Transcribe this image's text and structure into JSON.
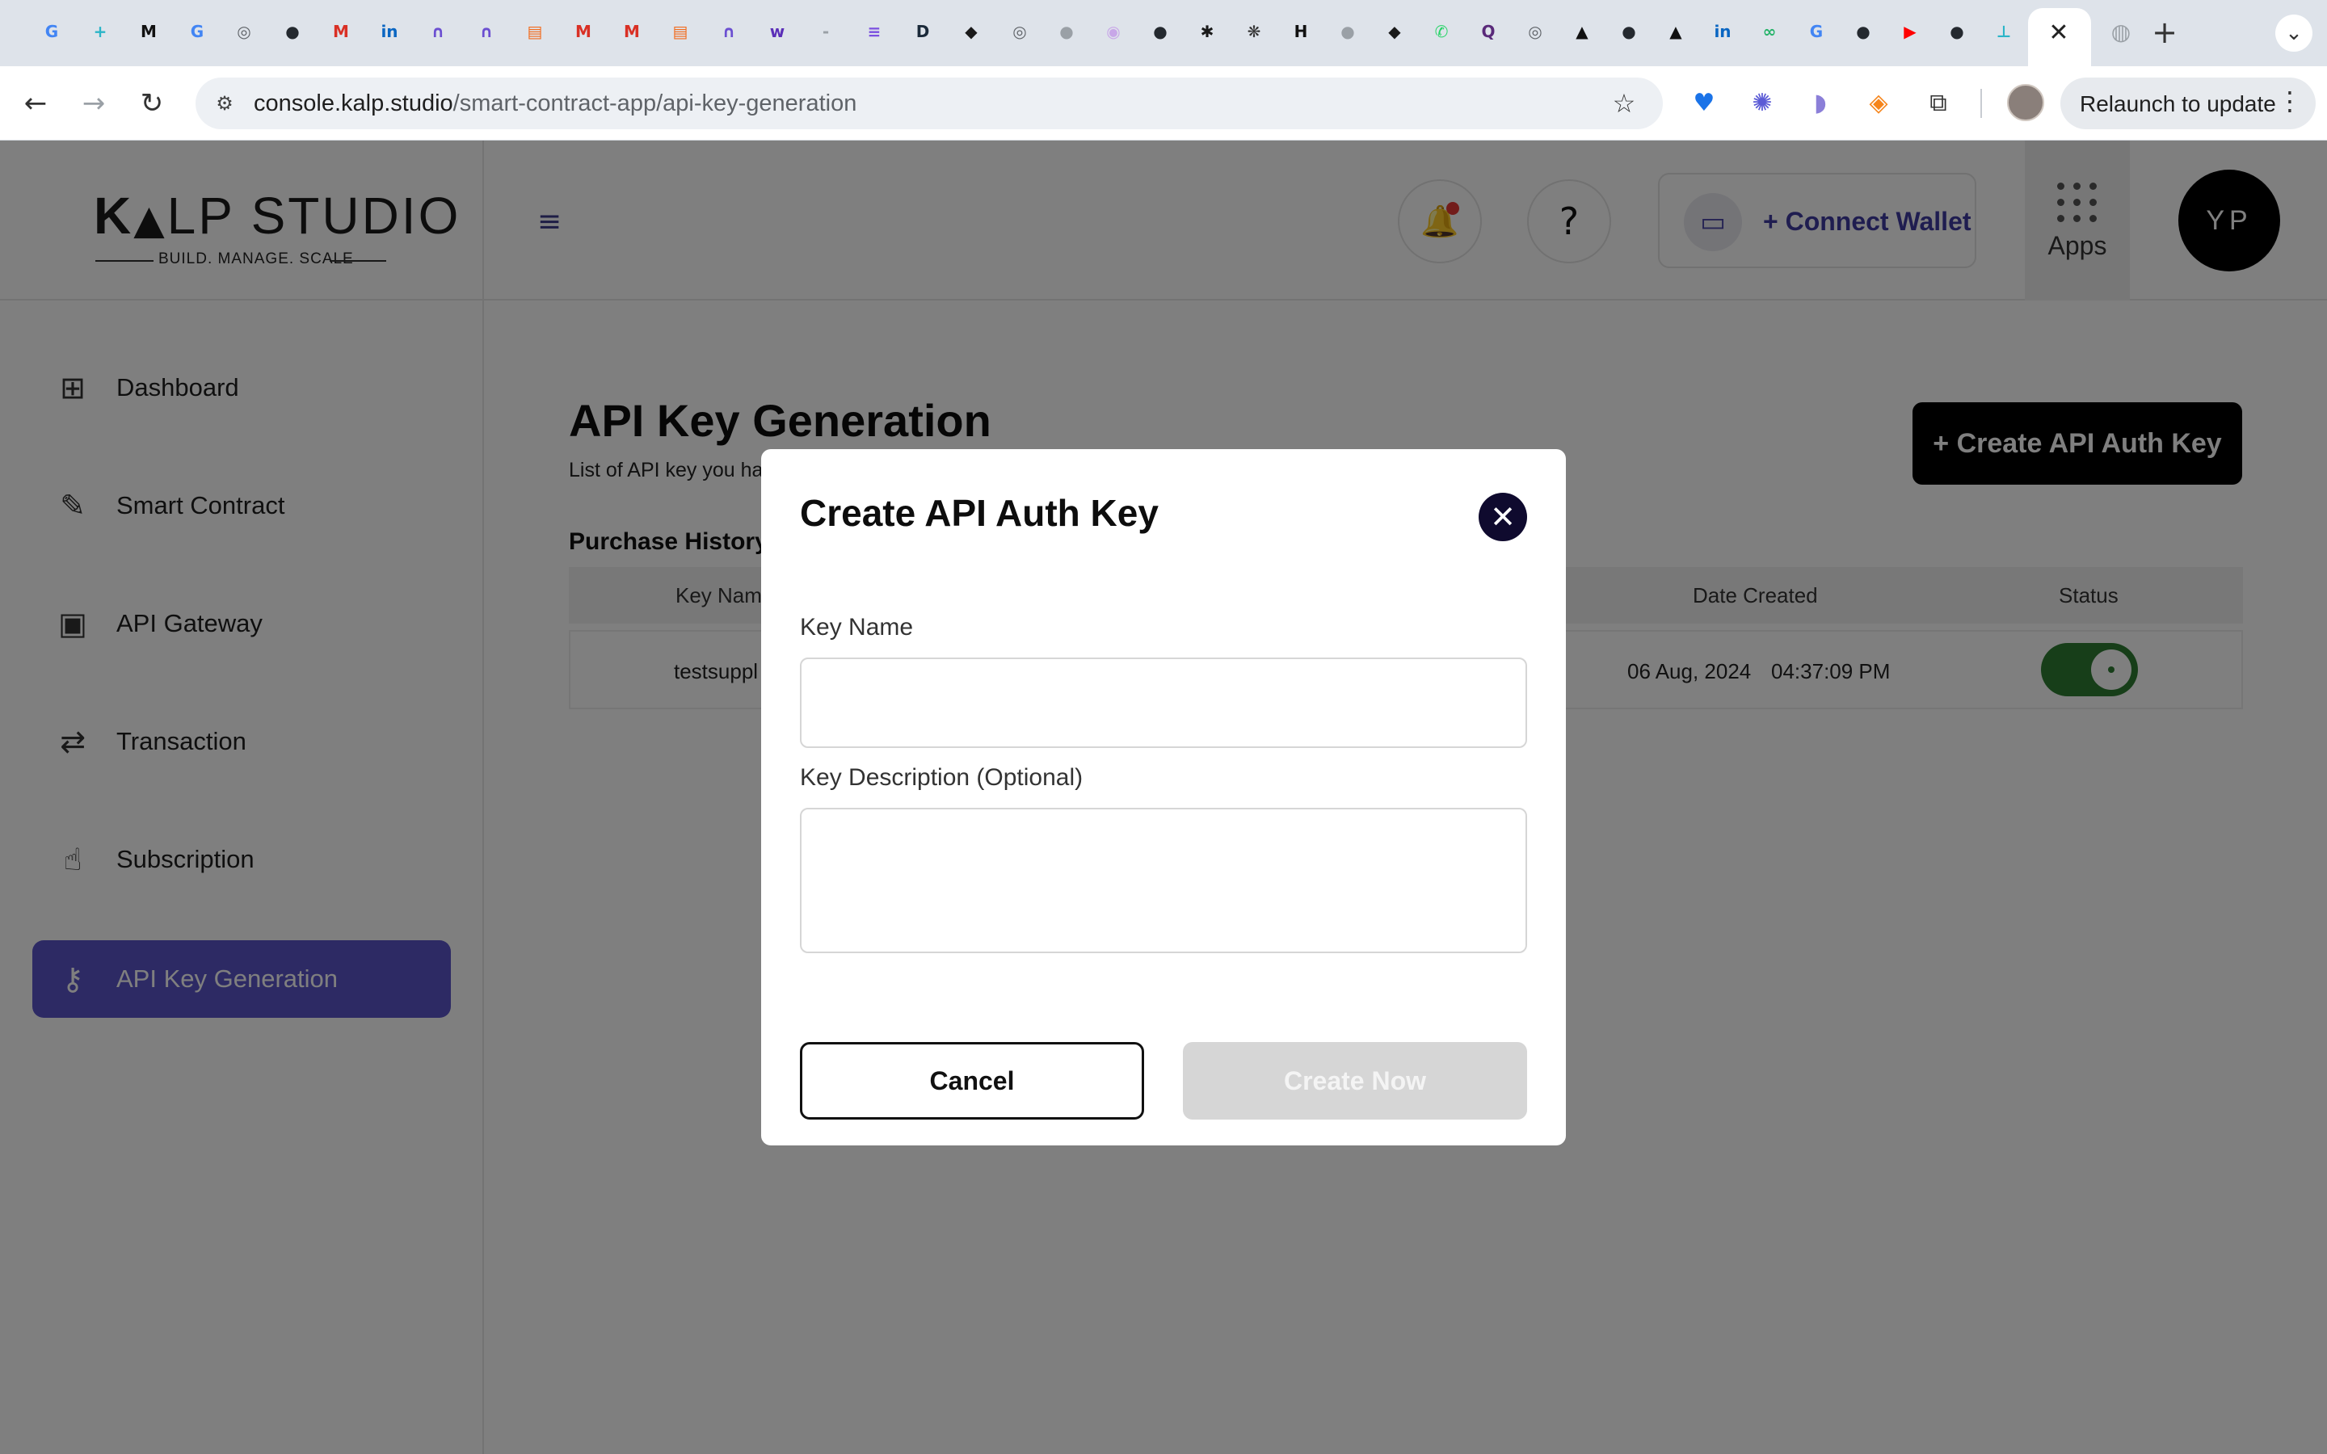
{
  "browser": {
    "tab_favicons": [
      {
        "icon": "google-icon",
        "glyph": "G",
        "color": "#4285f4"
      },
      {
        "icon": "crosshair-icon",
        "glyph": "+",
        "color": "#2bb5c8"
      },
      {
        "icon": "medium-icon",
        "glyph": "M",
        "color": "#111111"
      },
      {
        "icon": "google-icon",
        "glyph": "G",
        "color": "#4285f4"
      },
      {
        "icon": "chrome-icon",
        "glyph": "◎",
        "color": "#5f6368"
      },
      {
        "icon": "github-icon",
        "glyph": "●",
        "color": "#24292f"
      },
      {
        "icon": "gmail-icon",
        "glyph": "M",
        "color": "#d93025"
      },
      {
        "icon": "linkedin-icon",
        "glyph": "in",
        "color": "#0a66c2"
      },
      {
        "icon": "notion-like-icon",
        "glyph": "∩",
        "color": "#6b4fd1"
      },
      {
        "icon": "notion-like-icon",
        "glyph": "∩",
        "color": "#6b4fd1"
      },
      {
        "icon": "bookmark-app-icon",
        "glyph": "▤",
        "color": "#f26b1d"
      },
      {
        "icon": "gmail-icon",
        "glyph": "M",
        "color": "#d93025"
      },
      {
        "icon": "gmail-icon",
        "glyph": "M",
        "color": "#d93025"
      },
      {
        "icon": "bookmark-app-icon",
        "glyph": "▤",
        "color": "#f26b1d"
      },
      {
        "icon": "notion-like-icon",
        "glyph": "∩",
        "color": "#6b4fd1"
      },
      {
        "icon": "w-app-icon",
        "glyph": "w",
        "color": "#5b2fb8"
      },
      {
        "icon": "blank-page-icon",
        "glyph": "-",
        "color": "#9aa0a6"
      },
      {
        "icon": "solana-icon",
        "glyph": "≡",
        "color": "#7b4fe0"
      },
      {
        "icon": "d-app-icon",
        "glyph": "D",
        "color": "#1b2a3a"
      },
      {
        "icon": "ninja-icon",
        "glyph": "◆",
        "color": "#1a1a1a"
      },
      {
        "icon": "chrome-icon",
        "glyph": "◎",
        "color": "#5f6368"
      },
      {
        "icon": "github-icon",
        "glyph": "●",
        "color": "#9aa0a6"
      },
      {
        "icon": "target-icon",
        "glyph": "◉",
        "color": "#c8a7e8"
      },
      {
        "icon": "github-icon",
        "glyph": "●",
        "color": "#24292f"
      },
      {
        "icon": "asterisk-icon",
        "glyph": "✱",
        "color": "#1a1a1a"
      },
      {
        "icon": "openai-icon",
        "glyph": "❋",
        "color": "#333333"
      },
      {
        "icon": "h-app-icon",
        "glyph": "H",
        "color": "#111111"
      },
      {
        "icon": "github-icon",
        "glyph": "●",
        "color": "#9aa0a6"
      },
      {
        "icon": "ninja-icon",
        "glyph": "◆",
        "color": "#1a1a1a"
      },
      {
        "icon": "whatsapp-icon",
        "glyph": "✆",
        "color": "#25d366"
      },
      {
        "icon": "q-app-icon",
        "glyph": "Q",
        "color": "#5a2a7a"
      },
      {
        "icon": "chrome-icon",
        "glyph": "◎",
        "color": "#5f6368"
      },
      {
        "icon": "triangle-app-icon",
        "glyph": "▲",
        "color": "#111111"
      },
      {
        "icon": "github-icon",
        "glyph": "●",
        "color": "#24292f"
      },
      {
        "icon": "triangle-app-icon",
        "glyph": "▲",
        "color": "#111111"
      },
      {
        "icon": "linkedin-icon",
        "glyph": "in",
        "color": "#0a66c2"
      },
      {
        "icon": "infinity-icon",
        "glyph": "∞",
        "color": "#26b36a"
      },
      {
        "icon": "google-icon",
        "glyph": "G",
        "color": "#4285f4"
      },
      {
        "icon": "github-icon",
        "glyph": "●",
        "color": "#24292f"
      },
      {
        "icon": "youtube-icon",
        "glyph": "▶",
        "color": "#ff0000"
      },
      {
        "icon": "github-icon",
        "glyph": "●",
        "color": "#24292f"
      },
      {
        "icon": "pin-icon",
        "glyph": "⊥",
        "color": "#2bb5c8"
      }
    ],
    "active_tab_close": "✕",
    "inactive_tab_icon": "globe-icon",
    "new_tab": "+",
    "tab_search": "⌄",
    "nav": {
      "back": "←",
      "forward": "→",
      "reload": "↻"
    },
    "url_domain": "console.kalp.studio",
    "url_path": "/smart-contract-app/api-key-generation",
    "bookmark": "☆",
    "extensions": [
      {
        "icon": "heart-extension-icon",
        "glyph": "♥",
        "color": "#1a73e8"
      },
      {
        "icon": "sparkle-extension-icon",
        "glyph": "✺",
        "color": "#5b5bd6"
      },
      {
        "icon": "ghost-extension-icon",
        "glyph": "◗",
        "color": "#8b7fd8"
      },
      {
        "icon": "metamask-icon",
        "glyph": "◈",
        "color": "#f6851b"
      },
      {
        "icon": "puzzle-extensions-icon",
        "glyph": "⧉",
        "color": "#333333"
      }
    ],
    "relaunch_label": "Relaunch to update",
    "menu": "⋮"
  },
  "app": {
    "logo": {
      "word_prefix": "K",
      "word_a": "▲",
      "word_rest": "LP STUDIO",
      "tagline": "BUILD. MANAGE. SCALE"
    },
    "header": {
      "menu_toggle": "≡",
      "notification_icon": "🔔",
      "help_label": "?",
      "wallet_icon": "▭",
      "connect_wallet": "+ Connect Wallet",
      "apps_label": "Apps",
      "avatar_initials": "YP"
    },
    "sidebar": {
      "items": [
        {
          "label": "Dashboard",
          "icon": "grid-icon",
          "glyph": "⊞"
        },
        {
          "label": "Smart Contract",
          "icon": "contract-icon",
          "glyph": "✎"
        },
        {
          "label": "API Gateway",
          "icon": "chip-icon",
          "glyph": "▣"
        },
        {
          "label": "Transaction",
          "icon": "transfer-icon",
          "glyph": "⇄"
        },
        {
          "label": "Subscription",
          "icon": "pointer-icon",
          "glyph": "☝"
        },
        {
          "label": "API Key Generation",
          "icon": "key-icon",
          "glyph": "⚷"
        }
      ]
    },
    "main": {
      "title": "API Key Generation",
      "subtitle": "List of API key you ha",
      "create_button": "+ Create API Auth Key",
      "section_title": "Purchase History",
      "columns": {
        "key_name": "Key Nam",
        "date_created": "Date Created",
        "status": "Status"
      },
      "rows": [
        {
          "key_name": "testsuppl",
          "date": "06 Aug, 2024",
          "time": "04:37:09 PM",
          "status_on": true
        }
      ]
    },
    "modal": {
      "title": "Create API Auth Key",
      "close": "✕",
      "key_name_label": "Key Name",
      "key_name_value": "",
      "key_name_placeholder": "",
      "description_label": "Key Description (Optional)",
      "description_value": "",
      "description_placeholder": "",
      "cancel": "Cancel",
      "create": "Create Now"
    }
  },
  "colors": {
    "accent": "#5b55c8",
    "wallet_text": "#3f3aa0",
    "toggle_on": "#2e7d32",
    "overlay": "rgba(0,0,0,0.5)",
    "disabled_button": "#d6d6d6"
  }
}
